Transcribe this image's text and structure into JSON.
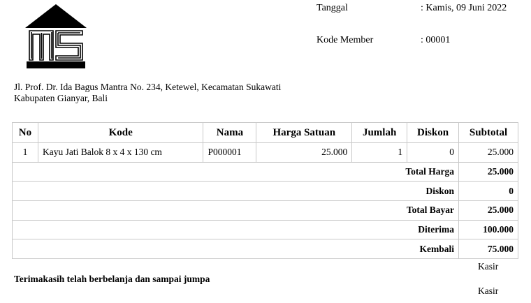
{
  "header": {
    "date_label": "Tanggal",
    "date_value": ": Kamis, 09 Juni 2022",
    "member_label": "Kode Member",
    "member_value": ": 00001"
  },
  "address": {
    "line1": "Jl. Prof. Dr. Ida Bagus Mantra No. 234, Ketewel, Kecamatan Sukawati",
    "line2": "Kabupaten Gianyar, Bali"
  },
  "table": {
    "headers": [
      "No",
      "Kode",
      "Nama",
      "Harga Satuan",
      "Jumlah",
      "Diskon",
      "Subtotal"
    ],
    "rows": [
      [
        "1",
        "Kayu Jati Balok 8 x 4 x 130 cm",
        "P000001",
        "25.000",
        "1",
        "0",
        "25.000"
      ]
    ],
    "summary": [
      {
        "label": "Total Harga",
        "value": "25.000"
      },
      {
        "label": "Diskon",
        "value": "0"
      },
      {
        "label": "Total Bayar",
        "value": "25.000"
      },
      {
        "label": "Diterima",
        "value": "100.000"
      },
      {
        "label": "Kembali",
        "value": "75.000"
      }
    ]
  },
  "footer": {
    "thanks": "Terimakasih telah berbelanja dan sampai jumpa",
    "cashier_top": "Kasir",
    "cashier_bottom": "Kasir"
  },
  "logo": {
    "icon": "house-ms-logo",
    "text": "MS"
  }
}
